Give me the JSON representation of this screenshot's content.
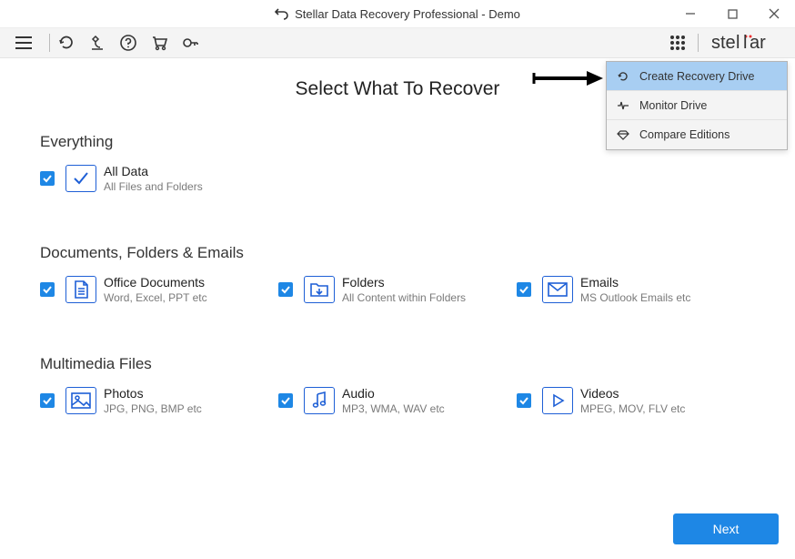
{
  "window": {
    "title": "Stellar Data Recovery Professional - Demo"
  },
  "brand": "stellar",
  "page_title": "Select What To Recover",
  "dropdown": {
    "items": [
      {
        "label": "Create Recovery Drive",
        "icon": "refresh-icon"
      },
      {
        "label": "Monitor Drive",
        "icon": "pulse-icon"
      },
      {
        "label": "Compare Editions",
        "icon": "diamond-icon"
      }
    ]
  },
  "sections": {
    "everything": {
      "heading": "Everything",
      "all_data": {
        "title": "All Data",
        "sub": "All Files and Folders"
      }
    },
    "docs": {
      "heading": "Documents, Folders & Emails",
      "office": {
        "title": "Office Documents",
        "sub": "Word, Excel, PPT etc"
      },
      "folders": {
        "title": "Folders",
        "sub": "All Content within Folders"
      },
      "emails": {
        "title": "Emails",
        "sub": "MS Outlook Emails etc"
      }
    },
    "media": {
      "heading": "Multimedia Files",
      "photos": {
        "title": "Photos",
        "sub": "JPG, PNG, BMP etc"
      },
      "audio": {
        "title": "Audio",
        "sub": "MP3, WMA, WAV etc"
      },
      "videos": {
        "title": "Videos",
        "sub": "MPEG, MOV, FLV etc"
      }
    }
  },
  "next_label": "Next"
}
